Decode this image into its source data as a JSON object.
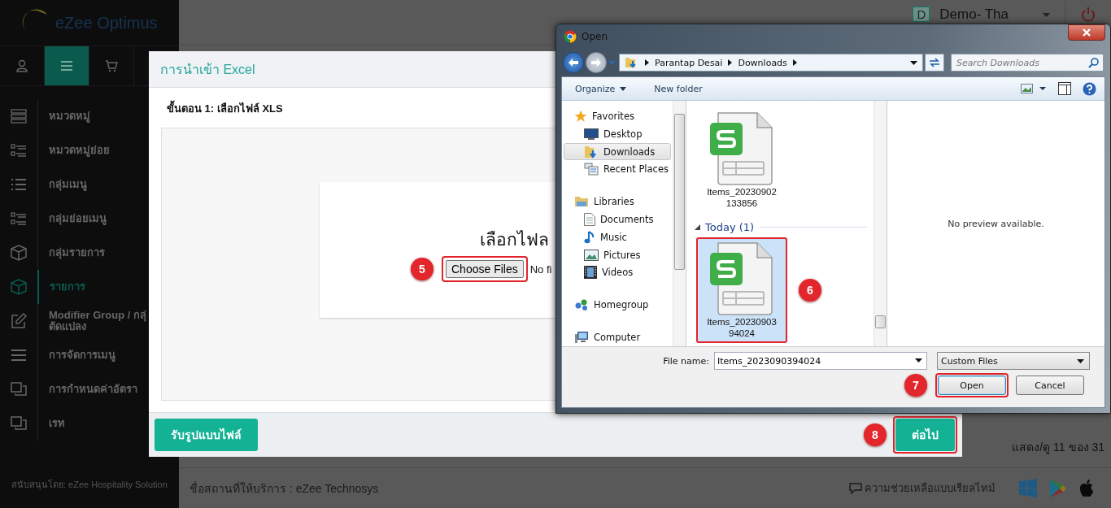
{
  "sidebar": {
    "logo": "eZee Optimus",
    "tabs": [
      {
        "kind": "user",
        "selected": false
      },
      {
        "kind": "menu",
        "selected": true
      },
      {
        "kind": "cart",
        "selected": false
      }
    ],
    "items": [
      {
        "label": "หมวดหมู่",
        "kind": "rows",
        "selected": false
      },
      {
        "label": "หมวดหมู่ย่อย",
        "kind": "sublist",
        "selected": false
      },
      {
        "label": "กลุ่มเมนู",
        "kind": "list",
        "selected": false
      },
      {
        "label": "กลุ่มย่อยเมนู",
        "kind": "sublist",
        "selected": false
      },
      {
        "label": "กลุ่มรายการ",
        "kind": "box",
        "selected": false
      },
      {
        "label": "รายการ",
        "kind": "box",
        "selected": true
      },
      {
        "label": "Modifier Group / กลุ่\nตัดแปลง",
        "kind": "edit",
        "selected": false
      },
      {
        "label": "การจัดการเมนู",
        "kind": "lines",
        "selected": false
      },
      {
        "label": "การกำหนดค่าอัตรา",
        "kind": "copy",
        "selected": false
      },
      {
        "label": "เรท",
        "kind": "copy",
        "selected": false
      }
    ],
    "footer": "สนับสนุนโดย: eZee Hospitality Solution"
  },
  "header": {
    "avatar": "D",
    "user": "Demo- Tha"
  },
  "pager": "แสดง/ดู 11 ของ 31",
  "footer": {
    "venue": "ชื่อสถานที่ให้บริการ : eZee Technosys",
    "help": "ความช่วยเหลือแบบเรียลไทม์"
  },
  "modal": {
    "title": "การนำเข้า Excel",
    "step": "ขั้นตอน 1: เลือกไฟล์ XLS",
    "upload": {
      "heading": "เลือกไฟล",
      "button": {
        "label": "Choose Files",
        "callout": "5",
        "highlighted": true
      },
      "status": "No fi"
    },
    "buttons": [
      {
        "label": "รับรูปแบบไฟล์",
        "highlighted": false
      },
      {
        "label": "ต่อไป",
        "callout": "8",
        "highlighted": true
      }
    ]
  },
  "dialog": {
    "title": "Open",
    "path": [
      "Parantap Desai",
      "Downloads"
    ],
    "search": {
      "placeholder": "Search Downloads"
    },
    "toolbar": [
      {
        "label": "Organize",
        "dropdown": true
      },
      {
        "label": "New folder",
        "dropdown": false
      }
    ],
    "nav": [
      {
        "label": "Favorites",
        "kind": "star",
        "selected": false,
        "children": [
          {
            "label": "Desktop",
            "kind": "desktop",
            "selected": false
          },
          {
            "label": "Downloads",
            "kind": "folder",
            "selected": true
          },
          {
            "label": "Recent Places",
            "kind": "recent",
            "selected": false
          }
        ]
      },
      {
        "label": "Libraries",
        "kind": "library",
        "selected": false,
        "children": [
          {
            "label": "Documents",
            "kind": "document",
            "selected": false
          },
          {
            "label": "Music",
            "kind": "music",
            "selected": false
          },
          {
            "label": "Pictures",
            "kind": "pictures",
            "selected": false
          },
          {
            "label": "Videos",
            "kind": "videos",
            "selected": false
          }
        ]
      },
      {
        "label": "Homegroup",
        "kind": "homegroup",
        "selected": false
      },
      {
        "label": "Computer",
        "kind": "computer",
        "selected": false
      }
    ],
    "files": [
      {
        "kind": "file",
        "name": "Items_20230902133856",
        "selected": false,
        "highlighted": false
      },
      {
        "kind": "group",
        "label": "Today (1)"
      },
      {
        "kind": "file",
        "name": "Items_2023090394024",
        "selected": true,
        "highlighted": true,
        "callout": "6"
      }
    ],
    "preview": "No preview available.",
    "file_name": {
      "label": "File name:",
      "value": "Items_2023090394024"
    },
    "file_type": "Custom Files",
    "buttons": [
      {
        "label": "Open",
        "highlighted": true,
        "callout": "7"
      },
      {
        "label": "Cancel",
        "highlighted": false
      }
    ]
  }
}
